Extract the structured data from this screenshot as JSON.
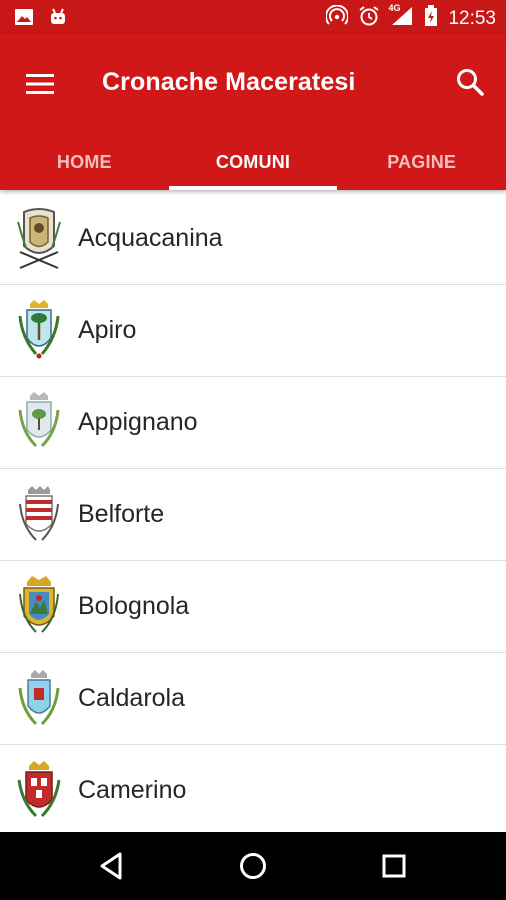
{
  "status_bar": {
    "time": "12:53",
    "network_label": "4G",
    "icons": [
      "image-notification-icon",
      "android-notification-icon",
      "hotspot-icon",
      "alarm-icon",
      "signal-icon",
      "battery-charging-icon"
    ]
  },
  "app_bar": {
    "title": "Cronache Maceratesi",
    "menu_icon": "hamburger-menu-icon",
    "search_icon": "search-icon",
    "color": "#d11818"
  },
  "tabs": [
    {
      "label": "HOME",
      "active": false
    },
    {
      "label": "COMUNI",
      "active": true
    },
    {
      "label": "PAGINE",
      "active": false
    }
  ],
  "comuni": [
    {
      "name": "Acquacanina",
      "icon": "acquacanina-crest-icon"
    },
    {
      "name": "Apiro",
      "icon": "apiro-crest-icon"
    },
    {
      "name": "Appignano",
      "icon": "appignano-crest-icon"
    },
    {
      "name": "Belforte",
      "icon": "belforte-crest-icon"
    },
    {
      "name": "Bolognola",
      "icon": "bolognola-crest-icon"
    },
    {
      "name": "Caldarola",
      "icon": "caldarola-crest-icon"
    },
    {
      "name": "Camerino",
      "icon": "camerino-crest-icon"
    }
  ],
  "nav_bar": {
    "icons": [
      "back-icon",
      "home-icon",
      "recents-icon"
    ]
  }
}
